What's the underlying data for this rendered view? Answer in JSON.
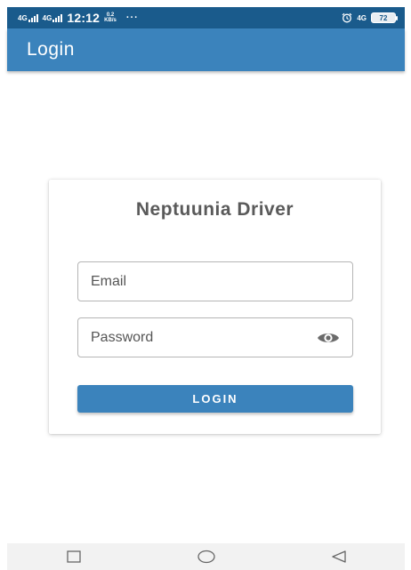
{
  "status_bar": {
    "network_1": "4G",
    "network_2": "4G",
    "time": "12:12",
    "speed_value": "0.2",
    "speed_unit": "KB/s",
    "more": "···",
    "network_right": "4G",
    "battery": "72"
  },
  "app_bar": {
    "title": "Login"
  },
  "login_card": {
    "title": "Neptuunia Driver",
    "email_placeholder": "Email",
    "email_value": "",
    "password_placeholder": "Password",
    "password_value": "",
    "login_label": "LOGIN"
  },
  "nav_bar": {
    "icons": [
      "recent-apps-icon",
      "home-icon",
      "back-icon"
    ]
  },
  "colors": {
    "status_bar": "#1a5b8c",
    "accent": "#3b83bc",
    "title_text": "#5a5a5a",
    "field_border": "#b5b5b5",
    "nav_bar": "#f2f2f2"
  }
}
